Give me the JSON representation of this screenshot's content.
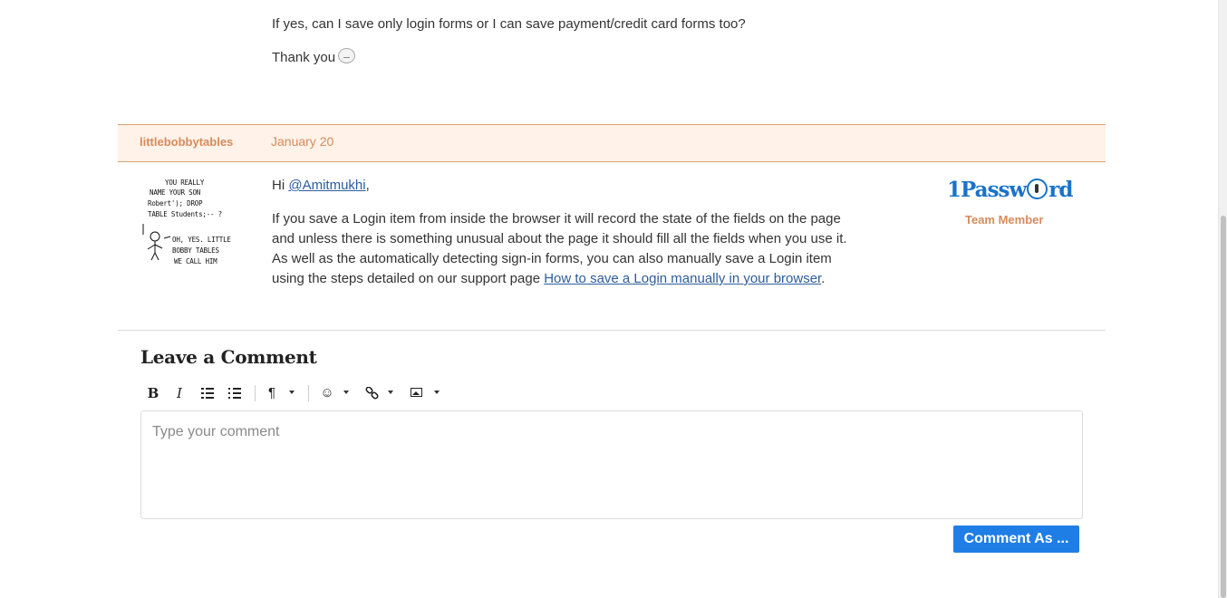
{
  "previous_comment": {
    "line1": "If yes, can I save only login forms or I can save payment/credit card forms too?",
    "line2": "Thank you",
    "emoji_icon": "smiley-icon"
  },
  "comment": {
    "author": "littlebobbytables",
    "date": "January 20",
    "avatar_comic_text": [
      "YOU REALLY",
      "NAME YOUR SON",
      "Robert'); DROP",
      "TABLE Students;-- ?",
      "OH, YES. LITTLE",
      "BOBBY TABLES",
      "WE CALL HIM"
    ],
    "greeting_prefix": "Hi ",
    "mention": "@Amitmukhi",
    "greeting_suffix": ",",
    "body_text": "If you save a Login item from inside the browser it will record the state of the fields on the page and unless there is something unusual about the page it should fill all the fields when you use it. As well as the automatically detecting sign-in forms, you can also manually save a Login item using the steps detailed on our support page ",
    "body_link": "How to save a Login manually in your browser",
    "body_end": ".",
    "brand_before": "1Passw",
    "brand_after": "rd",
    "role": "Team Member"
  },
  "leave_comment": {
    "title": "Leave a Comment",
    "toolbar": {
      "bold": "B",
      "italic": "I",
      "paragraph": "¶",
      "emoji": "☺",
      "link": "🔗"
    },
    "placeholder": "Type your comment",
    "submit_label": "Comment As ..."
  },
  "colors": {
    "accent_orange": "#d68b5c",
    "header_bg": "#fff2e8",
    "link_blue": "#2c5d9b",
    "button_blue": "#1f7ee6",
    "brand_blue": "#1a73c9"
  }
}
